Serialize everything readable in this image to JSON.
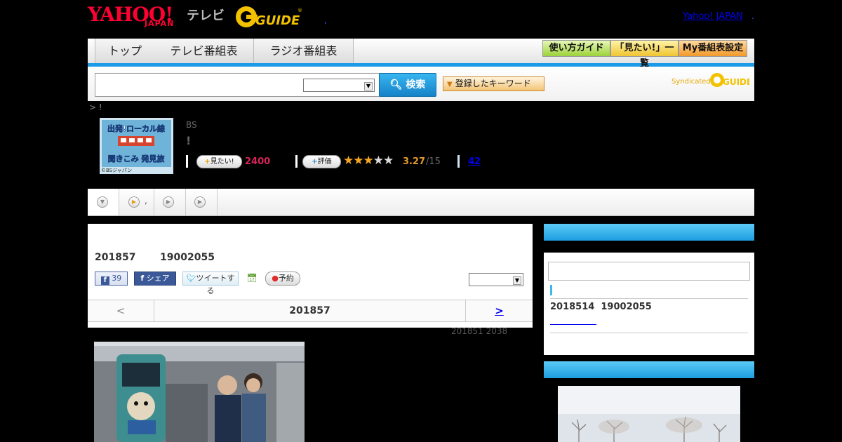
{
  "header": {
    "yahoo_logo": "YAHOO!",
    "yahoo_sub": "JAPAN",
    "tv_label": "テレビ",
    "guide_logo": "G GUIDE",
    "comma": ",",
    "yahoo_link": "Yahoo! JAPAN",
    "dot": "."
  },
  "nav": {
    "tabs": [
      "トップ",
      "テレビ番組表",
      "ラジオ番組表"
    ],
    "buttons": [
      "使い方ガイド",
      "「見たい!」一覧",
      "My番組表設定"
    ]
  },
  "search": {
    "input_value": "",
    "select_value": "",
    "button_label": "検索",
    "keyword_button": "登録したキーワード",
    "syndicated_label": "Syndicated",
    "syndicated_logo": "GUIDE"
  },
  "breadcrumb": "> !",
  "program": {
    "channel": "BS",
    "title": "!",
    "thumb_caption": "©BSジャパン",
    "thumb_title1": "出発!ローカル線",
    "thumb_title2": "聞きこみ 発見旅",
    "want_label": "見たい!",
    "want_count": "2400",
    "rate_label": "評価",
    "rating_value": "3.27",
    "rating_max": "/15",
    "rating_stars": 3,
    "review_count": "42"
  },
  "tabs_row": {
    "tab2_label": ","
  },
  "episode": {
    "date": "201857",
    "time": "19002055",
    "fb_like_count": "39",
    "share_label": "シェア",
    "tweet_label": "ツイートする",
    "reserve_label": "予約",
    "select_value": "",
    "pager_prev": "<",
    "pager_current": "201857",
    "pager_next": ">",
    "updated": "201851  2038"
  },
  "sidebar": {
    "next_date": "2018514",
    "next_time": "19002055"
  },
  "colors": {
    "accent_blue": "#1e9be6",
    "want_pink": "#d6245a",
    "rating_orange": "#e49a2c",
    "yahoo_red": "#ff0033"
  }
}
